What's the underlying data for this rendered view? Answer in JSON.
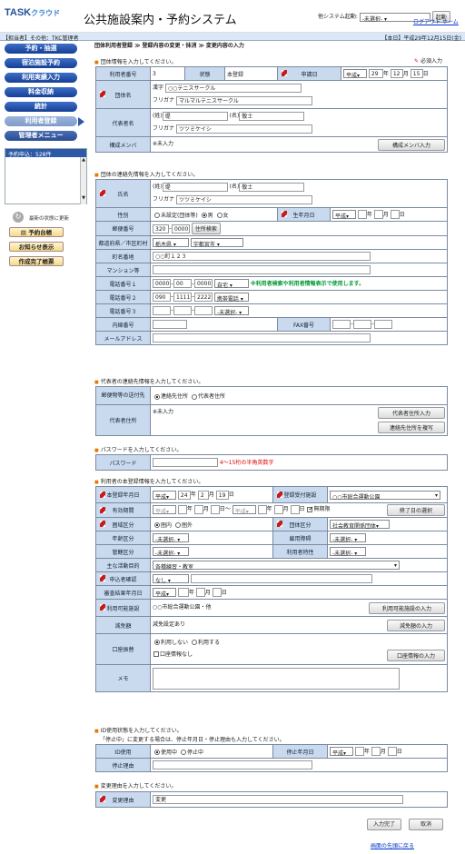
{
  "header": {
    "logo_brand": "TASK",
    "logo_kana": "クラウド",
    "system_title": "公共施設案内・予約システム",
    "other_system_label": "他システム起動:",
    "other_system_value": "-未選択-",
    "launch_button": "起動",
    "logout_link": "ログアウト",
    "home_link": "ホーム"
  },
  "bar": {
    "role": "【担当者】その他：TKC管理者",
    "today": "【本日】平成29年12月15日(金)"
  },
  "sidebar": {
    "items": [
      "予約・抽選",
      "宿泊施設予約",
      "利用実績入力",
      "料金収納",
      "統計",
      "利用者登録",
      "管理者メニュー"
    ],
    "pending_title": "予約申込：528件",
    "refresh": "最新の状態に更新",
    "reservation_ledger": "予約台帳",
    "notice": "お知らせ表示",
    "created_slip": "作成完了帳票"
  },
  "crumb": "団体利用者登録 ≫ 登録内容の変更・抹消 ≫ 変更内容の入力",
  "required_note": "必須入力",
  "s1": {
    "heading": "団体情報を入力してください。",
    "user_no_label": "利用者番号",
    "user_no": "3",
    "status_label": "状態",
    "status": "本登録",
    "apply_date_label": "申請日",
    "era": "平成",
    "year": "29",
    "month": "12",
    "day": "15",
    "year_unit": "年",
    "month_unit": "月",
    "day_unit": "日",
    "group_name_label": "団体名",
    "kanji_label": "漢字",
    "kanji": "○○テニスサークル",
    "kana_label": "フリガナ",
    "kana": "マルマルテニスサークル",
    "rep_label": "代表者名",
    "sei_label": "(姓)",
    "sei": "堤",
    "mei_label": "(名)",
    "mei": "敬士",
    "rep_kana": "ツツミケイシ",
    "members_label": "構成メンバ",
    "members": "※未入力",
    "members_button": "構成メンバ入力"
  },
  "s2": {
    "heading": "団体の連絡先情報を入力してください。",
    "name_label": "氏名",
    "sei_label": "(姓)",
    "sei": "堤",
    "mei_label": "(名)",
    "mei": "敬士",
    "kana_label": "フリガナ",
    "kana": "ツツミケイシ",
    "gender_label": "性別",
    "gender_opts": [
      "未設定(団体等)",
      "男",
      "女"
    ],
    "birth_label": "生年月日",
    "era": "平成",
    "zip_label": "郵便番号",
    "zip1": "320",
    "zip2": "0000",
    "zip_button": "住所検索",
    "pref_label": "都道府県／市区町村",
    "pref": "栃木県",
    "city": "宇都宮市",
    "town_label": "町名番地",
    "town": "○○町１２３",
    "bldg_label": "マンション等",
    "tel1_label": "電話番号１",
    "tel1a": "0000",
    "tel1b": "00",
    "tel1c": "0000",
    "tel1type": "自宅",
    "tel_note": "※利用者検索や利用者情報表示で使用します。",
    "tel2_label": "電話番号２",
    "tel2a": "090",
    "tel2b": "1111",
    "tel2c": "2222",
    "tel2type": "携帯電話",
    "tel3_label": "電話番号３",
    "tel3type": "-未選択-",
    "ext_label": "内線番号",
    "fax_label": "FAX番号",
    "mail_label": "メールアドレス"
  },
  "s3": {
    "heading": "代表者の連絡先情報を入力してください。",
    "mail_dest_label": "郵便物等の送付先",
    "mail_dest_opts": [
      "連絡先住所",
      "代表者住所"
    ],
    "addr_label": "代表者住所",
    "addr": "※未入力",
    "addr_button": "代表者住所入力",
    "copy_button": "連絡先住所を複写"
  },
  "s4": {
    "heading": "パスワードを入力してください。",
    "pw_label": "パスワード",
    "pw_hint": "4～15桁の半角英数字"
  },
  "s5": {
    "heading": "利用者の本登録情報を入力してください。",
    "reg_date_label": "本登録年月日",
    "era": "平成",
    "year": "24",
    "month": "2",
    "day": "19",
    "office_label": "登録受付施設",
    "office": "○○市総合運動公園",
    "valid_label": "有効期間",
    "tilde": "～",
    "unlimited": "無期限",
    "end_button": "終了日の選択",
    "area_label": "圏域区分",
    "area_opts": [
      "圏内",
      "圏外"
    ],
    "group_type_label": "団体区分",
    "group_type": "社会教育関係団体",
    "age_label": "年齢区分",
    "unselected": "-未選択-",
    "employ_label": "雇用障碍",
    "jurisdiction_label": "管轄区分",
    "attr_label": "利用者特性",
    "activity_label": "主な活動目的",
    "activity": "各種練習・教室",
    "app_confirm_label": "申込者確認",
    "app_confirm": "なし",
    "cert_date_label": "審査結果年月日",
    "facility_label": "利用可能施設",
    "facility": "○○市総合運動公園・他",
    "facility_button": "利用可能施設の入力",
    "discount_label": "減免額",
    "discount": "減免設定あり",
    "discount_button": "減免額の入力",
    "account_label": "口座振替",
    "account_opts": [
      "利用しない",
      "利用する"
    ],
    "account_note": "口座情報なし",
    "account_button": "口座情報の入力",
    "memo_label": "メモ"
  },
  "s6": {
    "heading": "ID使用状態を入力してください。",
    "sub": "「停止中」に変更する場合は、停止年月日・停止理由も入力してください。",
    "id_label": "ID使用",
    "id_opts": [
      "使用中",
      "停止中"
    ],
    "stop_date_label": "停止年月日",
    "era": "平成",
    "reason_label": "停止理由"
  },
  "s7": {
    "heading": "変更理由を入力してください。",
    "reason_label": "変更理由",
    "reason": "変更"
  },
  "buttons": {
    "done": "入力完了",
    "cancel": "取消"
  },
  "back_to_top": "画面の先頭に戻る"
}
